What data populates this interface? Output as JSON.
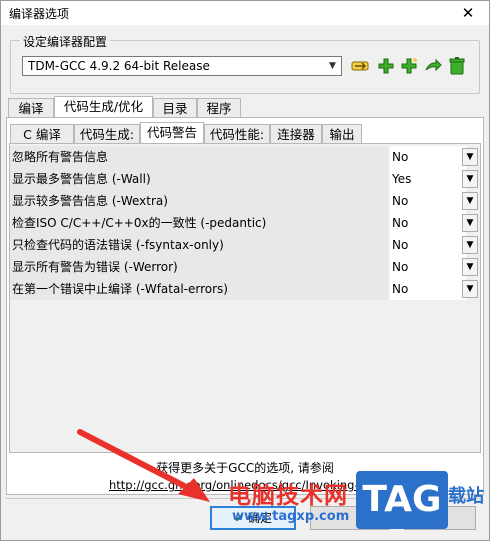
{
  "window": {
    "title": "编译器选项",
    "close_label": "✕"
  },
  "config": {
    "group_title": "设定编译器配置",
    "selected": "TDM-GCC 4.9.2 64-bit Release",
    "icons": [
      "rename-icon",
      "add-icon",
      "add-copy-icon",
      "export-icon",
      "delete-icon"
    ]
  },
  "main_tabs": [
    "编译器",
    "代码生成/优化",
    "目录",
    "程序"
  ],
  "sub_tabs": [
    "C 编译器:",
    "代码生成:",
    "代码警告",
    "代码性能:",
    "连接器",
    "输出"
  ],
  "options": [
    {
      "label": "忽略所有警告信息",
      "value": "No"
    },
    {
      "label": "显示最多警告信息 (-Wall)",
      "value": "Yes"
    },
    {
      "label": "显示较多警告信息 (-Wextra)",
      "value": "No"
    },
    {
      "label": "检查ISO C/C++/C++0x的一致性 (-pedantic)",
      "value": "No"
    },
    {
      "label": "只检查代码的语法错误 (-fsyntax-only)",
      "value": "No"
    },
    {
      "label": "显示所有警告为错误 (-Werror)",
      "value": "No"
    },
    {
      "label": "在第一个错误中止编译 (-Wfatal-errors)",
      "value": "No"
    }
  ],
  "info": {
    "text": "获得更多关于GCC的选项, 请参阅",
    "link": "http://gcc.gnu.org/onlinedocs/gcc/Invoking-GCC.html"
  },
  "buttons": {
    "ok": "确定"
  },
  "watermark": {
    "cn": "电脑技术网",
    "url": "www.tagxp.com",
    "logo": "TAG",
    "side": "载站"
  },
  "colors": {
    "accent": "#2b80d8",
    "watermark_red": "#e8322b",
    "watermark_blue": "#2b70c9"
  }
}
